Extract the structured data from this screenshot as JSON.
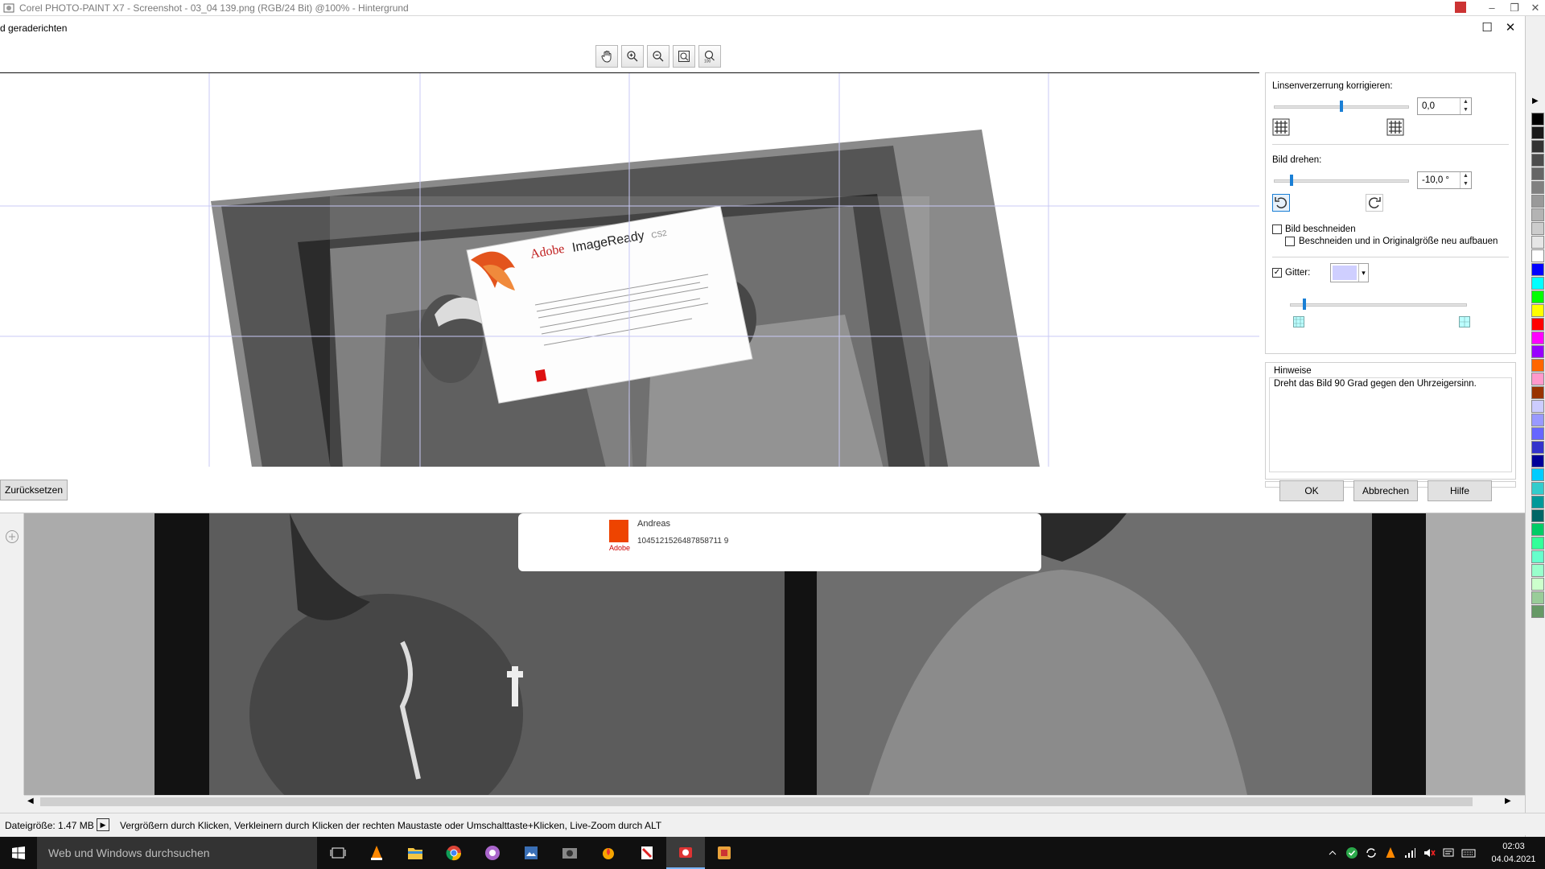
{
  "window": {
    "title": "Corel PHOTO-PAINT X7 - Screenshot - 03_04 139.png (RGB/24 Bit) @100% - Hintergrund",
    "buttons": [
      "–",
      "❐",
      "✕"
    ]
  },
  "dialog": {
    "title": "d geraderichten",
    "maximize": "☐",
    "close": "✕",
    "toolbar": [
      "hand-pan-icon",
      "zoom-in-icon",
      "zoom-out-icon",
      "zoom-fit-icon",
      "zoom-100-icon"
    ],
    "reset_label": "Zurücksetzen",
    "ok_label": "OK",
    "cancel_label": "Abbrechen",
    "help_label": "Hilfe"
  },
  "options": {
    "lens_label": "Linsenverzerrung korrigieren:",
    "lens_value": "0,0",
    "lens_slider_fraction": 0.5,
    "rotate_label": "Bild drehen:",
    "rotate_value": "-10,0 °",
    "crop_label": "Bild beschneiden",
    "crop_checked": false,
    "rebuild_label": "Beschneiden und in Originalgröße neu aufbauen",
    "rebuild_checked": false,
    "grid_label": "Gitter:",
    "grid_checked": true,
    "grid_color": "#cfcfff"
  },
  "hints": {
    "title": "Hinweise",
    "text": "Dreht das Bild 90 Grad gegen den Uhrzeigersinn."
  },
  "preview": {
    "about_title_adobe": "Adobe",
    "about_title_product": "ImageReady",
    "about_title_version": "CS2"
  },
  "canvas": {
    "user_name": "Andreas",
    "serial": "1045121526487858711 9"
  },
  "status": {
    "file_size": "Dateigröße: 1.47 MB",
    "hint": "Vergrößern durch Klicken, Verkleinern durch Klicken der rechten Maustaste oder Umschalttaste+Klicken, Live-Zoom durch ALT"
  },
  "taskbar": {
    "search_placeholder": "Web und Windows durchsuchen",
    "time": "02:03",
    "date": "04.04.2021"
  },
  "palette_colors": [
    "#000000",
    "#1a1a1a",
    "#333333",
    "#4d4d4d",
    "#666666",
    "#808080",
    "#999999",
    "#b3b3b3",
    "#cccccc",
    "#e6e6e6",
    "#ffffff",
    "#0000ff",
    "#00ffff",
    "#00ff00",
    "#ffff00",
    "#ff0000",
    "#ff00ff",
    "#9900ff",
    "#ff6600",
    "#ff99cc",
    "#993300",
    "#ccccff",
    "#9999ff",
    "#6666ff",
    "#3333cc",
    "#000099",
    "#00ccff",
    "#33cccc",
    "#009999",
    "#006666",
    "#00cc66",
    "#33ff99",
    "#66ffcc",
    "#99ffcc",
    "#ccffcc",
    "#99cc99",
    "#669966"
  ]
}
